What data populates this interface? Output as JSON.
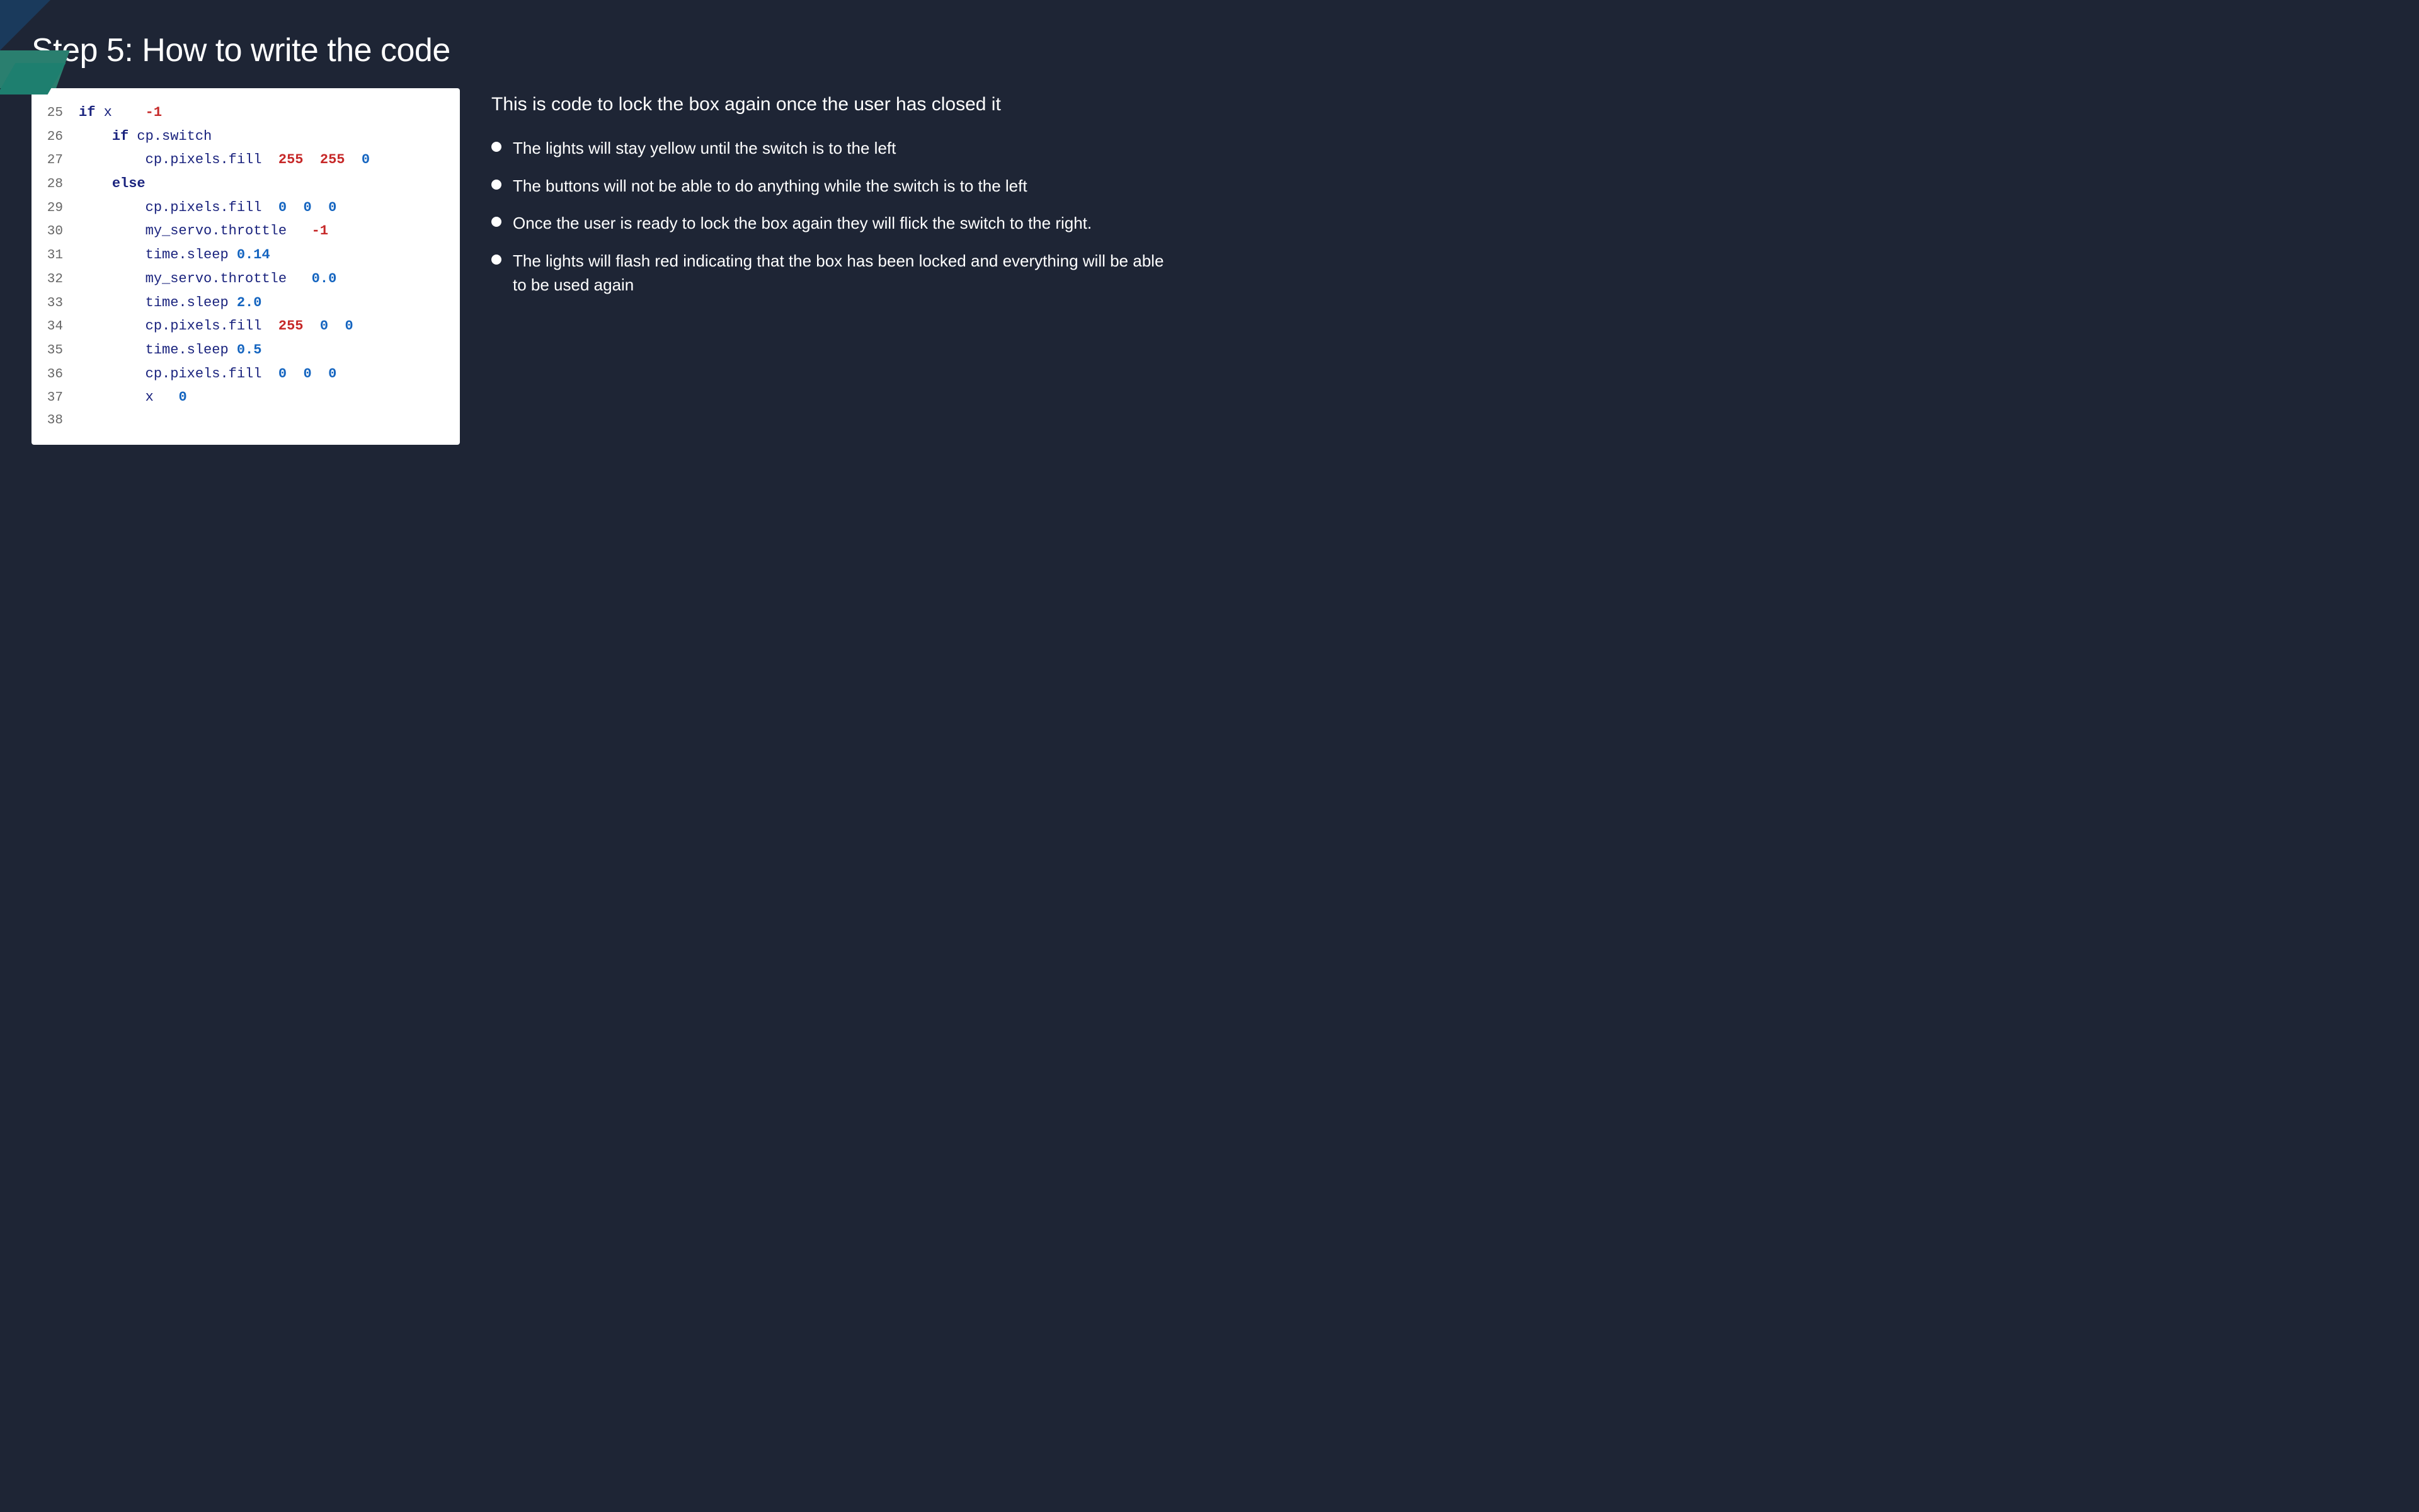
{
  "slide": {
    "title": "Step 5: How to write the code",
    "info_title": "This is code to lock the box again once the user has closed it",
    "bullets": [
      "The lights will stay yellow until the switch is to the left",
      "The buttons will not be able to do anything while the switch is to the left",
      "Once the user is ready to lock the box again they will flick the switch to the right.",
      "The lights will flash red indicating that the box has been locked and everything will be able to be used again"
    ],
    "code_lines": [
      {
        "num": "25",
        "content": "if x == -1:"
      },
      {
        "num": "26",
        "content": "    if cp.switch:"
      },
      {
        "num": "27",
        "content": "        cp.pixels.fill((255, 255, 0))"
      },
      {
        "num": "28",
        "content": "    else:"
      },
      {
        "num": "29",
        "content": "        cp.pixels.fill((0, 0, 0))"
      },
      {
        "num": "30",
        "content": "        my_servo.throttle = -1"
      },
      {
        "num": "31",
        "content": "        time.sleep(0.14)"
      },
      {
        "num": "32",
        "content": "        my_servo.throttle = 0.0"
      },
      {
        "num": "33",
        "content": "        time.sleep(2.0)"
      },
      {
        "num": "34",
        "content": "        cp.pixels.fill((255, 0, 0))"
      },
      {
        "num": "35",
        "content": "        time.sleep(0.5)"
      },
      {
        "num": "36",
        "content": "        cp.pixels.fill((0, 0, 0))"
      },
      {
        "num": "37",
        "content": "        x = 0"
      },
      {
        "num": "38",
        "content": ""
      }
    ]
  }
}
